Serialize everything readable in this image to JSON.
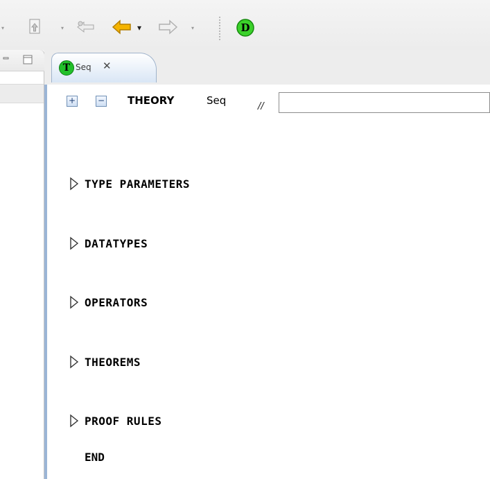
{
  "toolbar": {
    "items": [
      {
        "icon": "next-annotation-icon"
      },
      {
        "icon": "back-history-icon"
      },
      {
        "icon": "back-arrow-icon"
      },
      {
        "icon": "forward-arrow-icon"
      },
      {
        "icon": "d-badge-icon",
        "badge_text": "D"
      }
    ],
    "colors": {
      "back_arrow": "#f5b400",
      "badge_green": "#3bd12a"
    }
  },
  "editor": {
    "tab": {
      "label": "Seq",
      "icon_text": "T",
      "close_glyph": "✕"
    },
    "header": {
      "keyword": "THEORY",
      "name": "Seq",
      "comment_marker": "//",
      "comment_value": ""
    },
    "sections": [
      {
        "label": "TYPE PARAMETERS"
      },
      {
        "label": "DATATYPES"
      },
      {
        "label": "OPERATORS"
      },
      {
        "label": "THEOREMS"
      },
      {
        "label": "PROOF RULES"
      }
    ],
    "end_label": "END"
  }
}
